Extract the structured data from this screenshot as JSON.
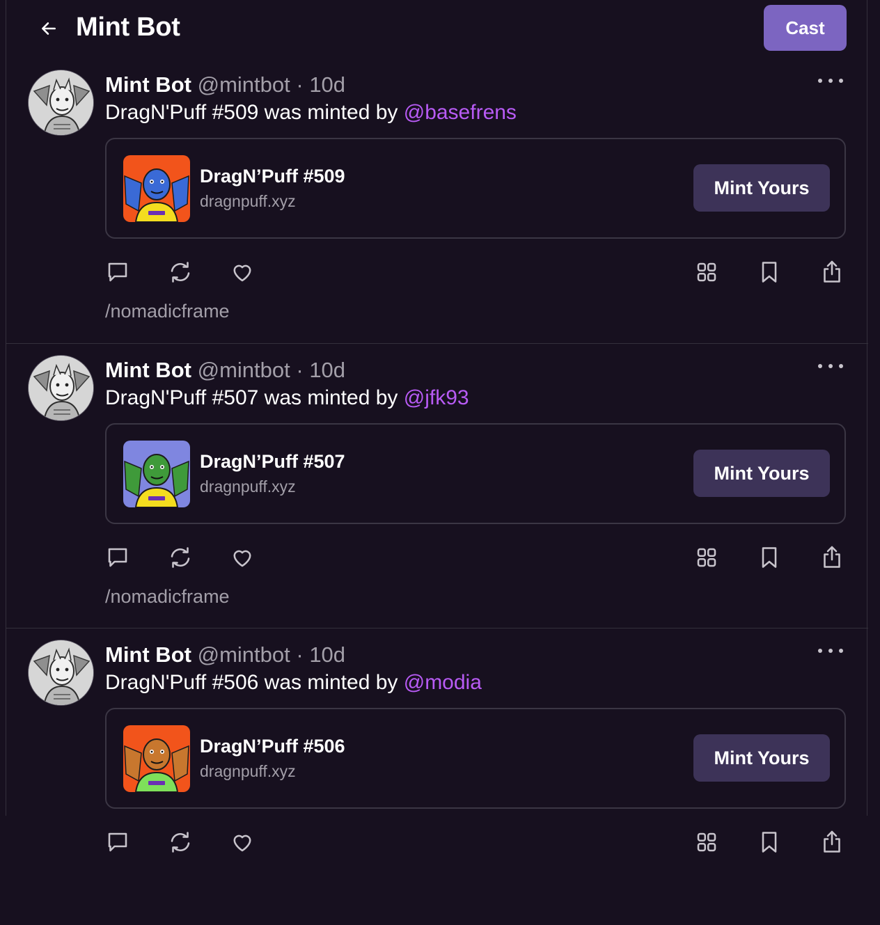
{
  "header": {
    "title": "Mint Bot",
    "cast_label": "Cast"
  },
  "posts": [
    {
      "author_name": "Mint Bot",
      "author_handle": "@mintbot",
      "separator": "·",
      "age": "10d",
      "text_prefix": "DragN'Puff #509 was minted by ",
      "mention": "@basefrens",
      "embed": {
        "title": "DragN’Puff #509",
        "domain": "dragnpuff.xyz",
        "button_label": "Mint Yours",
        "dragon_color": "#3a6ad6",
        "bg_color": "#f2541b",
        "shirt_color": "#f4dd1f"
      },
      "channel": "/nomadicframe"
    },
    {
      "author_name": "Mint Bot",
      "author_handle": "@mintbot",
      "separator": "·",
      "age": "10d",
      "text_prefix": "DragN'Puff #507 was minted by ",
      "mention": "@jfk93",
      "embed": {
        "title": "DragN’Puff #507",
        "domain": "dragnpuff.xyz",
        "button_label": "Mint Yours",
        "dragon_color": "#3f9a3a",
        "bg_color": "#7f86e0",
        "shirt_color": "#f4dd1f"
      },
      "channel": "/nomadicframe"
    },
    {
      "author_name": "Mint Bot",
      "author_handle": "@mintbot",
      "separator": "·",
      "age": "10d",
      "text_prefix": "DragN'Puff #506 was minted by ",
      "mention": "@modia",
      "embed": {
        "title": "DragN’Puff #506",
        "domain": "dragnpuff.xyz",
        "button_label": "Mint Yours",
        "dragon_color": "#c8772e",
        "bg_color": "#f2541b",
        "shirt_color": "#7ee05a"
      },
      "channel": null
    }
  ],
  "colors": {
    "background": "#17101f",
    "accent": "#7c65c1",
    "mention": "#b85bf5",
    "mint_button": "#3d3358",
    "muted_text": "#a39fa9"
  },
  "icons": [
    "back-arrow-icon",
    "more-icon",
    "reply-icon",
    "recast-icon",
    "like-icon",
    "apps-grid-icon",
    "bookmark-icon",
    "share-icon"
  ]
}
